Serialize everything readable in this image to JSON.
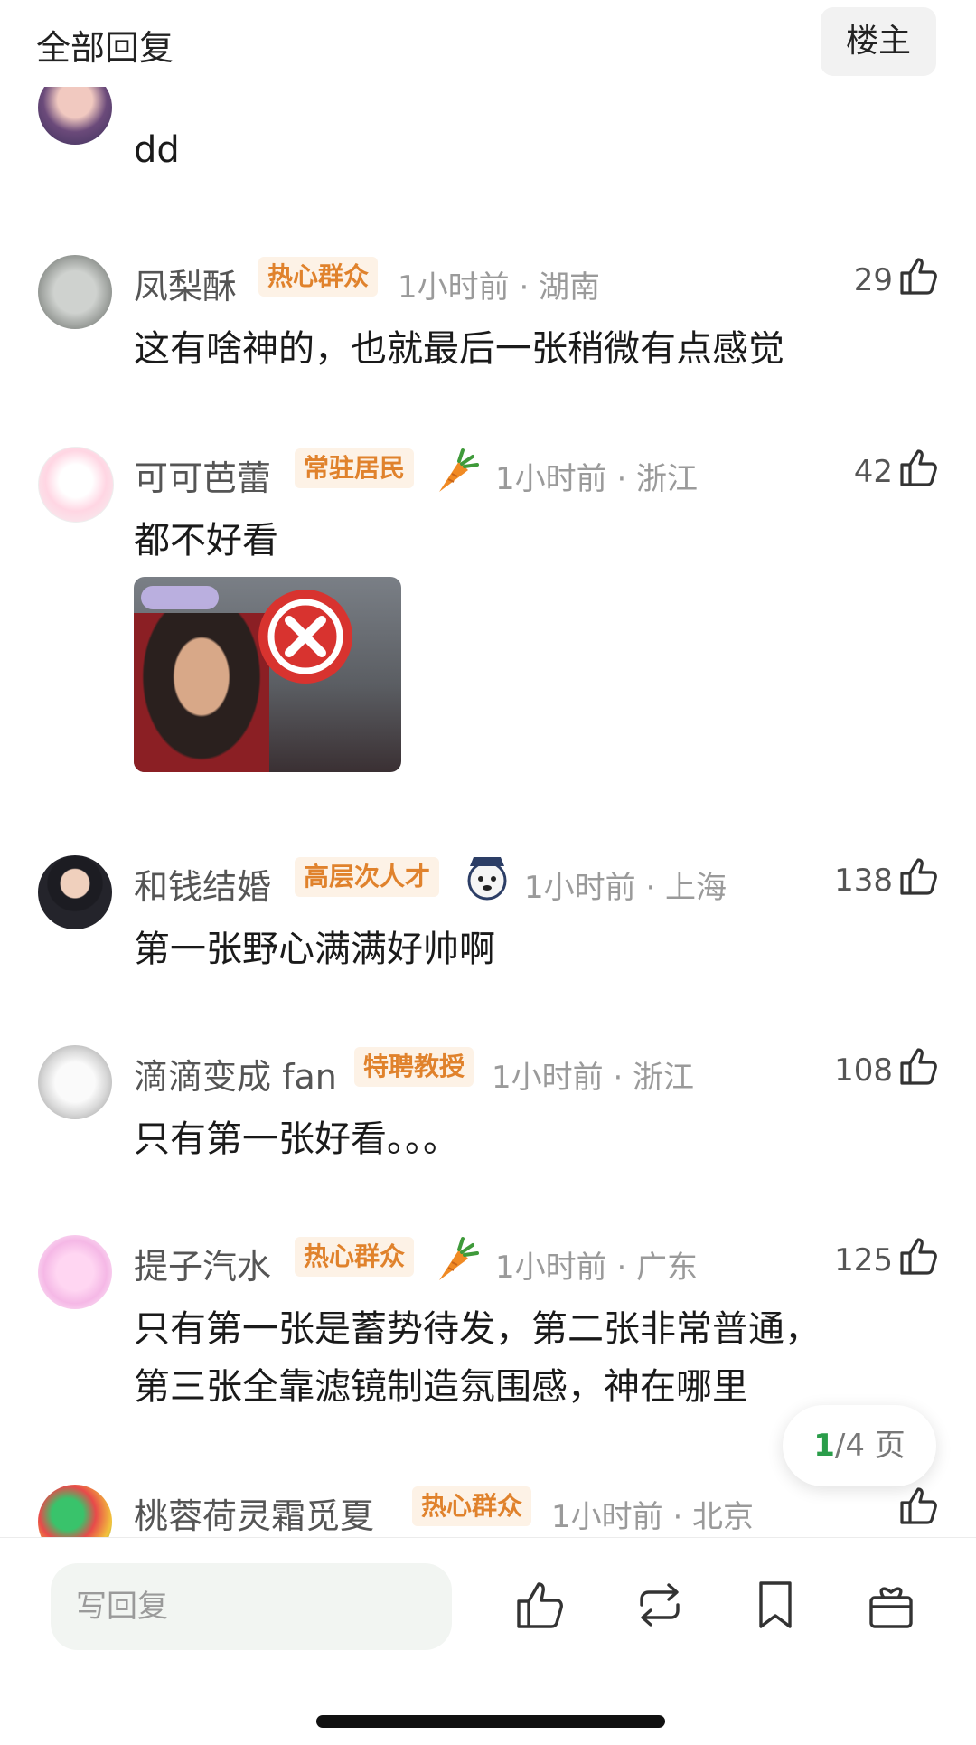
{
  "header": {
    "title": "全部回复",
    "owner_button": "楼主"
  },
  "partial_top": {
    "text": "dd"
  },
  "comments": [
    {
      "username": "凤梨酥",
      "badge": "热心群众",
      "time_location": "1小时前 · 湖南",
      "likes": "29",
      "text": "这有啥神的，也就最后一张稍微有点感觉"
    },
    {
      "username": "可可芭蕾",
      "badge": "常驻居民",
      "time_location": "1小时前 · 浙江",
      "likes": "42",
      "text": "都不好看",
      "image_caption": "meme-photo-with-red-x-sign"
    },
    {
      "username": "和钱结婚",
      "badge": "高层次人才",
      "time_location": "1小时前 · 上海",
      "likes": "138",
      "text": "第一张野心满满好帅啊"
    },
    {
      "username": "滴滴变成 fan",
      "badge": "特聘教授",
      "time_location": "1小时前 · 浙江",
      "likes": "108",
      "text": "只有第一张好看。。。"
    },
    {
      "username": "提子汽水",
      "badge": "热心群众",
      "time_location": "1小时前 · 广东",
      "likes": "125",
      "text_line1": "只有第一张是蓄势待发，第二张非常普通，",
      "text_line2": "第三张全靠滤镜制造氛围感，神在哪里"
    },
    {
      "username": "桃蓉荷灵霜觅夏",
      "badge": "热心群众",
      "time_location": "1小时前 · 北京",
      "likes": ""
    }
  ],
  "pager": {
    "current": "1",
    "rest": "/4 页"
  },
  "bottom_bar": {
    "reply_placeholder": "写回复"
  },
  "colors": {
    "badge_text": "#e0822c",
    "badge_bg": "#fdf2e6",
    "pager_current": "#2a9d4a"
  }
}
